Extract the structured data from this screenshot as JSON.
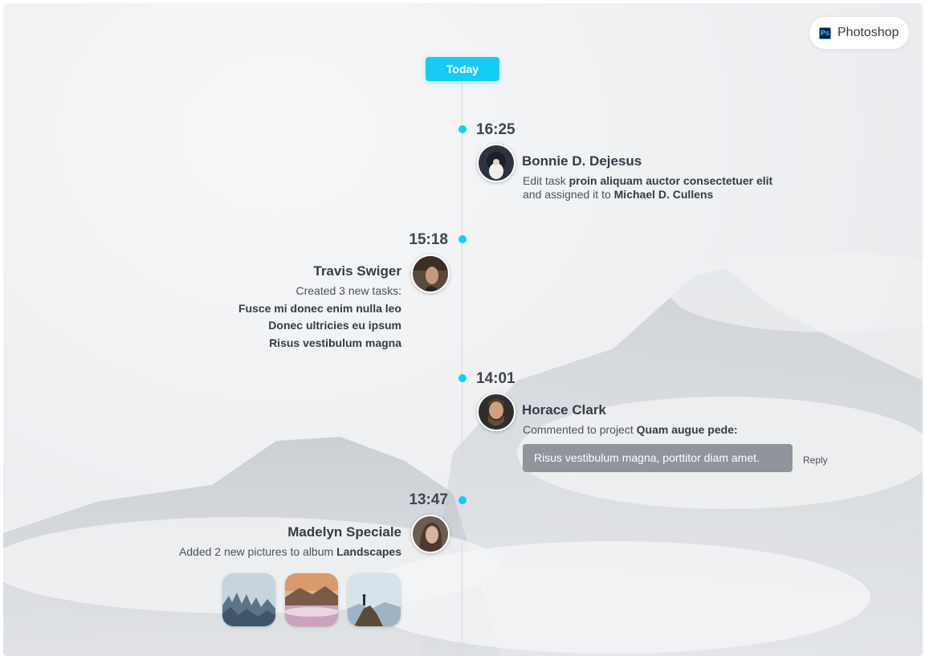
{
  "app_badge": {
    "icon": "photoshop-icon",
    "icon_glyph": "Ps",
    "label": "Photoshop"
  },
  "today_label": "Today",
  "colors": {
    "accent": "#14cdf4",
    "text_dark": "#343d45",
    "comment_bg": "#8f959b"
  },
  "events": [
    {
      "time": "16:25",
      "name": "Bonnie D. Dejesus",
      "line1_prefix": "Edit task ",
      "line1_bold": "proin aliquam auctor consectetuer elit",
      "line2_prefix": "and assigned it to ",
      "line2_bold": "Michael D. Cullens"
    },
    {
      "time": "15:18",
      "name": "Travis Swiger",
      "intro": "Created 3 new tasks:",
      "tasks": [
        "Fusce mi donec enim nulla leo",
        "Donec ultricies eu ipsum",
        "Risus vestibulum magna"
      ]
    },
    {
      "time": "14:01",
      "name": "Horace Clark",
      "line1_prefix": "Commented to project ",
      "line1_bold": "Quam augue pede:",
      "comment": "Risus vestibulum magna, porttitor diam amet.",
      "reply_label": "Reply"
    },
    {
      "time": "13:47",
      "name": "Madelyn Speciale",
      "line1_prefix": "Added 2 new pictures to album ",
      "line1_bold": "Landscapes"
    }
  ]
}
